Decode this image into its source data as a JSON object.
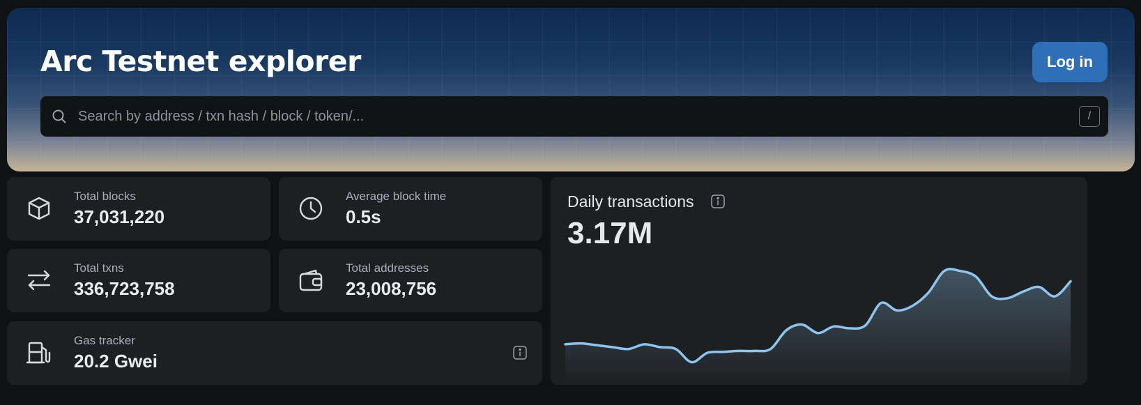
{
  "header": {
    "title": "Arc Testnet explorer",
    "login_label": "Log in"
  },
  "search": {
    "placeholder": "Search by address / txn hash / block / token/...",
    "shortcut": "/"
  },
  "stats": {
    "total_blocks": {
      "label": "Total blocks",
      "value": "37,031,220",
      "icon": "cube-icon"
    },
    "avg_block_time": {
      "label": "Average block time",
      "value": "0.5s",
      "icon": "clock-icon"
    },
    "total_txns": {
      "label": "Total txns",
      "value": "336,723,758",
      "icon": "arrows-exchange-icon"
    },
    "total_addresses": {
      "label": "Total addresses",
      "value": "23,008,756",
      "icon": "wallet-icon"
    },
    "gas_tracker": {
      "label": "Gas tracker",
      "value": "20.2 Gwei",
      "icon": "gas-pump-icon"
    }
  },
  "daily": {
    "title": "Daily transactions",
    "value": "3.17M"
  },
  "colors": {
    "accent": "#2f6eb8",
    "line": "#8ec5ef",
    "card": "#1e1f21",
    "background": "#101112"
  },
  "chart_data": {
    "type": "area",
    "y": [
      0.43,
      0.44,
      0.42,
      0.4,
      0.38,
      0.43,
      0.4,
      0.38,
      0.24,
      0.34,
      0.35,
      0.36,
      0.36,
      0.38,
      0.58,
      0.64,
      0.55,
      0.62,
      0.6,
      0.63,
      0.87,
      0.79,
      0.84,
      0.98,
      1.21,
      1.21,
      1.15,
      0.94,
      0.92,
      0.99,
      1.04,
      0.94,
      1.1
    ]
  }
}
